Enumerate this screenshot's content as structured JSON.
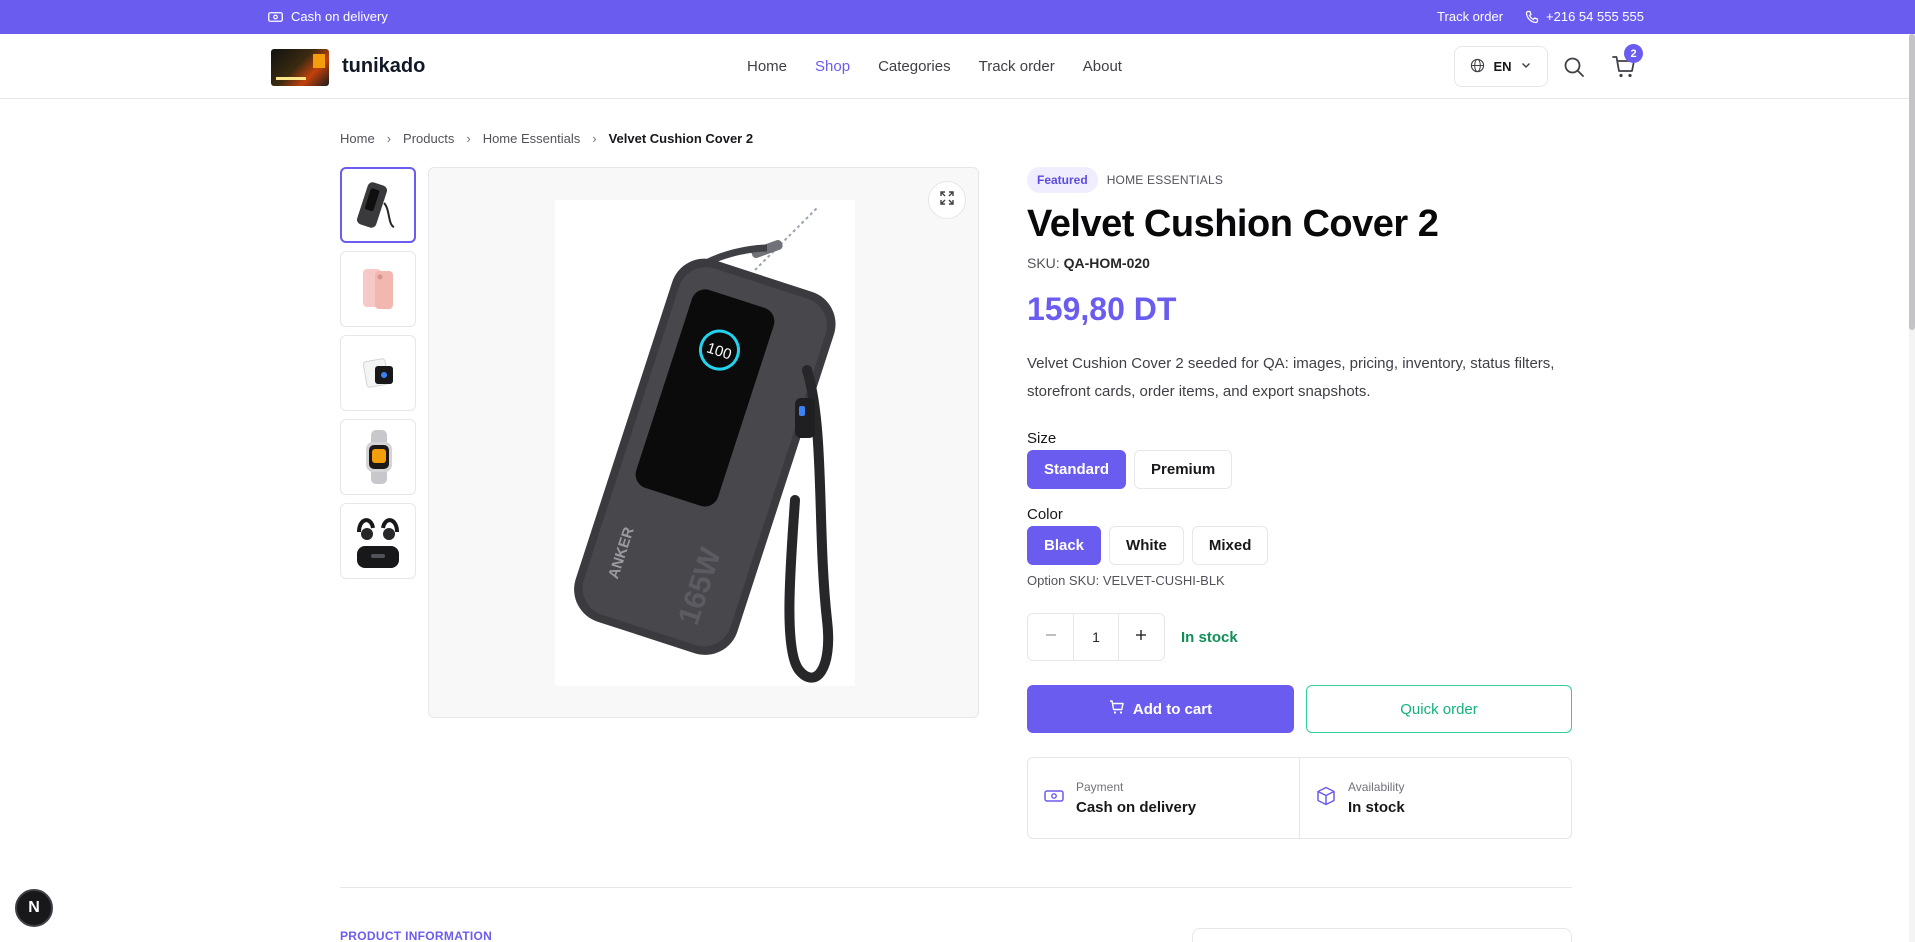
{
  "topbar": {
    "cod_label": "Cash on delivery",
    "track_label": "Track order",
    "phone": "+216 54 555 555"
  },
  "header": {
    "brand": "tunikado",
    "nav": [
      "Home",
      "Shop",
      "Categories",
      "Track order",
      "About"
    ],
    "active_nav": "Shop",
    "language": "EN",
    "cart_count": "2"
  },
  "breadcrumb": {
    "items": [
      "Home",
      "Products",
      "Home Essentials"
    ],
    "current": "Velvet Cushion Cover 2"
  },
  "product": {
    "badge": "Featured",
    "category": "HOME ESSENTIALS",
    "title": "Velvet Cushion Cover 2",
    "sku_label": "SKU:",
    "sku": "QA-HOM-020",
    "price": "159,80 DT",
    "description": "Velvet Cushion Cover 2 seeded for QA: images, pricing, inventory, status filters, storefront cards, order items, and export snapshots.",
    "size_label": "Size",
    "sizes": [
      "Standard",
      "Premium"
    ],
    "selected_size": "Standard",
    "color_label": "Color",
    "colors": [
      "Black",
      "White",
      "Mixed"
    ],
    "selected_color": "Black",
    "option_sku": "Option SKU: VELVET-CUSHI-BLK",
    "quantity": "1",
    "stock_status": "In stock",
    "add_to_cart": "Add to cart",
    "quick_order": "Quick order"
  },
  "info_box": {
    "payment_label": "Payment",
    "payment_value": "Cash on delivery",
    "availability_label": "Availability",
    "availability_value": "In stock"
  },
  "photo": {
    "brand_text": "ANKER",
    "wattage": "165W",
    "display_value": "100"
  },
  "section": {
    "label": "PRODUCT INFORMATION"
  },
  "dev_badge": "N",
  "colors": {
    "accent": "#6b5cf0",
    "success": "#0f8f57",
    "quick_order": "#2fcf9b"
  }
}
